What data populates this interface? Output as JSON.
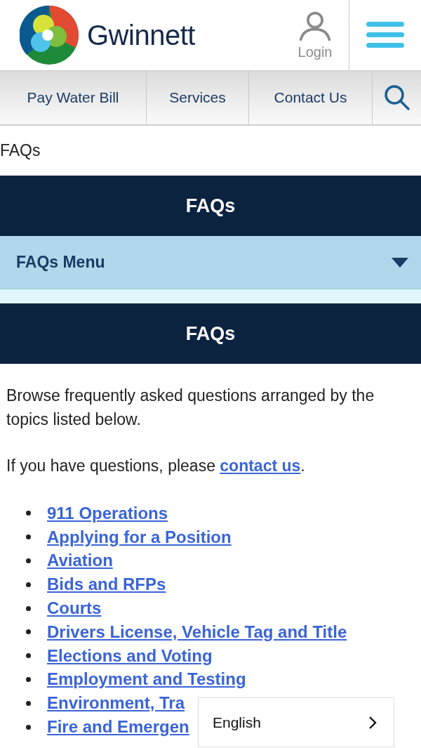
{
  "header": {
    "brand": "Gwinnett",
    "login": "Login"
  },
  "nav": [
    {
      "label": "Pay Water Bill"
    },
    {
      "label": "Services"
    },
    {
      "label": "Contact Us"
    }
  ],
  "breadcrumb": "FAQs",
  "banner_title": "FAQs",
  "section_menu": {
    "label": "FAQs Menu",
    "expanded": false
  },
  "page_title": "FAQs",
  "intro": "Browse frequently asked questions arranged by the topics listed below.",
  "contact": {
    "text": "If you have questions, please ",
    "link": "contact us",
    "after": "."
  },
  "topics": [
    {
      "label": "911 Operations"
    },
    {
      "label": "Applying for a Position"
    },
    {
      "label": "Aviation"
    },
    {
      "label": "Bids and RFPs"
    },
    {
      "label": "Courts"
    },
    {
      "label": "Drivers License, Vehicle Tag and Title"
    },
    {
      "label": "Elections and Voting"
    },
    {
      "label": "Employment and Testing"
    },
    {
      "label": "Environment, Tra"
    },
    {
      "label": "Fire and Emergen"
    }
  ],
  "language": {
    "label": "English"
  }
}
